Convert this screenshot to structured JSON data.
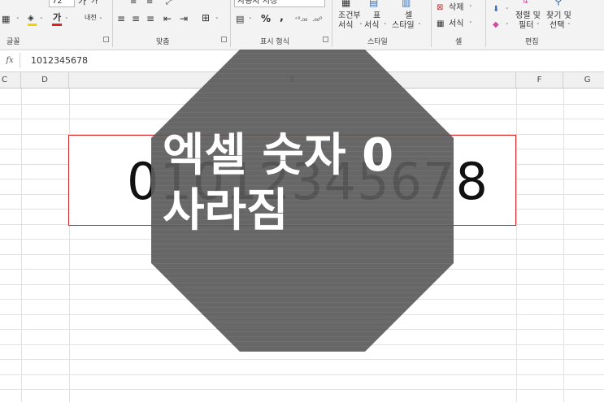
{
  "ribbon": {
    "font_group": {
      "label": "글꼴",
      "font_size": "72",
      "grow_label": "가",
      "shrink_label": "가",
      "font_color_label": "가",
      "phonetic_label": "내천"
    },
    "align_group": {
      "label": "맞춤"
    },
    "number_group": {
      "label": "표시 형식",
      "format_value": "사용자 지정",
      "percent": "%",
      "comma": ","
    },
    "style_group": {
      "label": "스타일",
      "conditional_format": [
        "조건부",
        "서식"
      ],
      "table_format": [
        "표",
        "서식"
      ],
      "cell_style": [
        "셀",
        "스타일"
      ]
    },
    "cells_group": {
      "label": "셀",
      "delete": "삭제",
      "format": "서식"
    },
    "editing_group": {
      "label": "편집",
      "sort_filter": [
        "정렬 및",
        "필터"
      ],
      "find_select": [
        "찾기 및",
        "선택"
      ]
    }
  },
  "formula_bar": {
    "fx": "fx",
    "value": "1012345678"
  },
  "columns": [
    "C",
    "D",
    "E",
    "F",
    "G"
  ],
  "cell": {
    "display": "01012345678"
  },
  "overlay": {
    "title": "엑셀 숫자 0 사라짐"
  },
  "colors": {
    "cell_border": "#d42020",
    "overlay": "#5a5a5a",
    "font_red": "#e02020"
  }
}
